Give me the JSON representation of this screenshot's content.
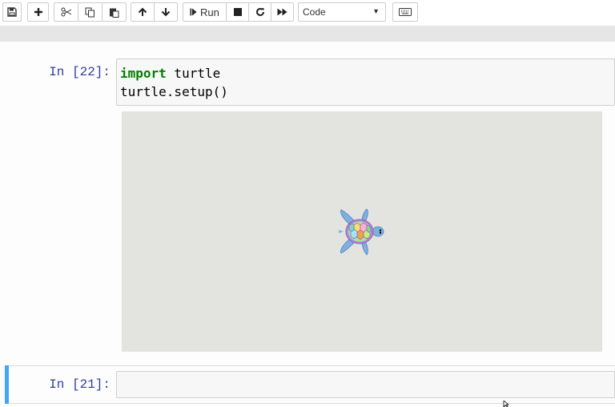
{
  "toolbar": {
    "buttons": [
      {
        "name": "save-button",
        "icon": "floppy-disk-icon"
      },
      {
        "name": "insert-cell-button",
        "icon": "plus-icon"
      },
      {
        "name": "cut-button",
        "icon": "scissors-icon"
      },
      {
        "name": "copy-button",
        "icon": "copy-icon"
      },
      {
        "name": "paste-button",
        "icon": "paste-icon"
      },
      {
        "name": "move-up-button",
        "icon": "arrow-up-icon"
      },
      {
        "name": "move-down-button",
        "icon": "arrow-down-icon"
      },
      {
        "name": "run-button",
        "icon": "step-forward-icon"
      },
      {
        "name": "interrupt-button",
        "icon": "stop-icon"
      },
      {
        "name": "restart-button",
        "icon": "refresh-icon"
      },
      {
        "name": "restart-run-all-button",
        "icon": "fast-forward-icon"
      },
      {
        "name": "command-palette-button",
        "icon": "keyboard-icon"
      }
    ],
    "run_label": "Run",
    "cell_type_selected": "Code"
  },
  "cells": [
    {
      "prompt": "In [22]:",
      "code_line1_keyword": "import",
      "code_line1_rest": " turtle",
      "code_line2": "turtle.setup()",
      "output": {
        "type": "turtle-canvas",
        "content": "turtle-icon"
      }
    },
    {
      "prompt": "In [21]:",
      "code": ""
    }
  ],
  "colors": {
    "prompt": "#303f9f",
    "keyword": "#008000",
    "selected_cell_bar": "#42a5f5",
    "canvas": "#e3e3df"
  }
}
